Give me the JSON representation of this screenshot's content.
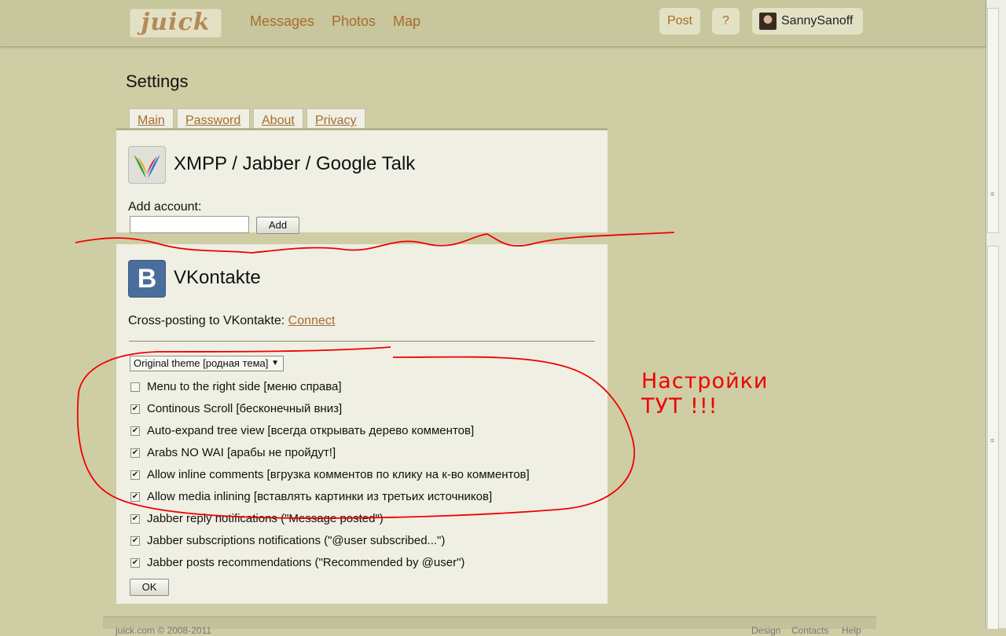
{
  "header": {
    "logo": "juick",
    "nav": [
      "Messages",
      "Photos",
      "Map"
    ],
    "post_label": "Post",
    "help_label": "?",
    "username": "SannySanoff"
  },
  "page_title": "Settings",
  "tabs": [
    "Main",
    "Password",
    "About",
    "Privacy"
  ],
  "xmpp": {
    "title": "XMPP / Jabber / Google Talk",
    "add_account_label": "Add account:",
    "account_value": "",
    "add_button": "Add"
  },
  "vk": {
    "icon_letter": "B",
    "title": "VKontakte",
    "crosspost_label": "Cross-posting to VKontakte:",
    "connect_link": "Connect"
  },
  "theme_select": {
    "selected": "Original theme [родная тема]"
  },
  "options": [
    {
      "label": "Menu to the right side [меню справа]",
      "checked": false
    },
    {
      "label": "Continous Scroll [бесконечный вниз]",
      "checked": true
    },
    {
      "label": "Auto-expand tree view [всегда открывать дерево комментов]",
      "checked": true
    },
    {
      "label": "Arabs NO WAI [арабы не пройдут!]",
      "checked": true
    },
    {
      "label": "Allow inline comments [вгрузка комментов по клику на к-во комментов]",
      "checked": true
    },
    {
      "label": "Allow media inlining [вставлять картинки из третьих источников]",
      "checked": true
    },
    {
      "label": "Jabber reply notifications (\"Message posted\")",
      "checked": true
    },
    {
      "label": "Jabber subscriptions notifications (\"@user subscribed...\")",
      "checked": true
    },
    {
      "label": "Jabber posts recommendations (\"Recommended by @user\")",
      "checked": true
    }
  ],
  "ok_button": "OK",
  "annotation": {
    "line1": "Настройки",
    "line2": "ТУТ !!!"
  },
  "footer": {
    "copyright": "juick.com © 2008-2011",
    "links": [
      "Design",
      "Contacts",
      "Help"
    ]
  },
  "colors": {
    "background": "#cfcda4",
    "link": "#a76c2e",
    "annotation": "#ee0000",
    "panel": "#efefe3"
  }
}
